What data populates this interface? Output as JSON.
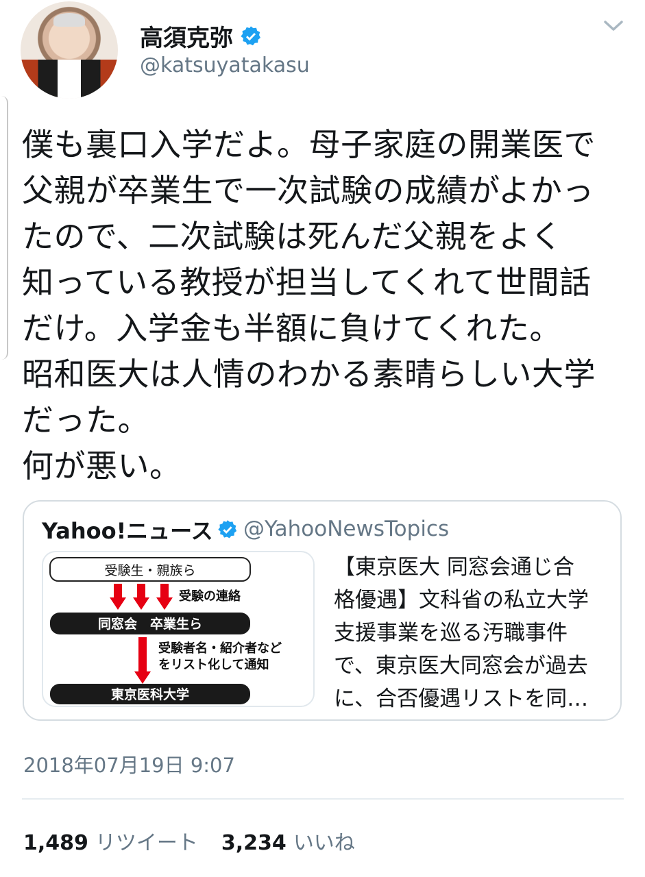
{
  "author": {
    "name": "高須克弥",
    "handle": "@katsuyatakasu"
  },
  "tweet": {
    "lines": [
      "僕も裏口入学だよ。母子家庭の開業医で",
      "父親が卒業生で一次試験の成績がよかっ",
      "たので、二次試験は死んだ父親をよく",
      "知っている教授が担当してくれて世間話",
      "だけ。入学金も半額に負けてくれた。",
      "昭和医大は人情のわかる素晴らしい大学",
      "だった。",
      "何が悪い。"
    ]
  },
  "quote": {
    "name": "Yahoo!ニュース",
    "handle": "@YahooNewsTopics",
    "text_lines": [
      "【東京医大 同窓会通じ合",
      "格優遇】文科省の私立大学",
      "支援事業を巡る汚職事件",
      "で、東京医大同窓会が過去",
      "に、合否優遇リストを同…"
    ],
    "diagram": {
      "top_box": "受験生・親族ら",
      "arrow1_label": "受験の連絡",
      "middle_box": "同窓会　卒業生ら",
      "arrow2_label_line1": "受験者名・紹介者など",
      "arrow2_label_line2": "をリスト化して通知",
      "bottom_box": "東京医科大学"
    }
  },
  "timestamp": "2018年07月19日 9:07",
  "stats": {
    "retweets": "1,489",
    "retweets_label": "リツイート",
    "likes": "3,234",
    "likes_label": "いいね"
  },
  "colors": {
    "verified_blue": "#1da1f2",
    "secondary_text": "#657786",
    "arrow_red": "#e60012"
  }
}
